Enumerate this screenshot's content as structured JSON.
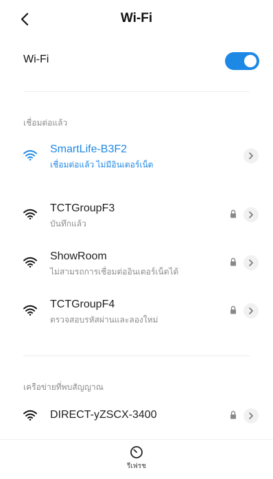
{
  "header": {
    "title": "Wi-Fi"
  },
  "wifi_toggle": {
    "label": "Wi-Fi",
    "on": true
  },
  "sections": {
    "connected_label": "เชื่อมต่อแล้ว",
    "available_label": "เครือข่ายที่พบสัญญาณ"
  },
  "networks": [
    {
      "name": "SmartLife-B3F2",
      "status": "เชื่อมต่อแล้ว ไม่มีอินเตอร์เน็ต",
      "locked": false,
      "connected": true
    },
    {
      "name": "TCTGroupF3",
      "status": "บันทึกแล้ว",
      "locked": true,
      "connected": false
    },
    {
      "name": "ShowRoom",
      "status": "ไม่สามรถการเชื่อมต่ออินเตอร์เน็ตได้",
      "locked": true,
      "connected": false
    },
    {
      "name": "TCTGroupF4",
      "status": "ตรวจสอบรหัสผ่านและลองใหม่",
      "locked": true,
      "connected": false
    },
    {
      "name": "DIRECT-yZSCX-3400",
      "status": "",
      "locked": true,
      "connected": false
    }
  ],
  "bottom": {
    "refresh_label": "รีเฟรช"
  },
  "colors": {
    "accent": "#1e88e5",
    "secondary_text": "#8c8c8c"
  }
}
